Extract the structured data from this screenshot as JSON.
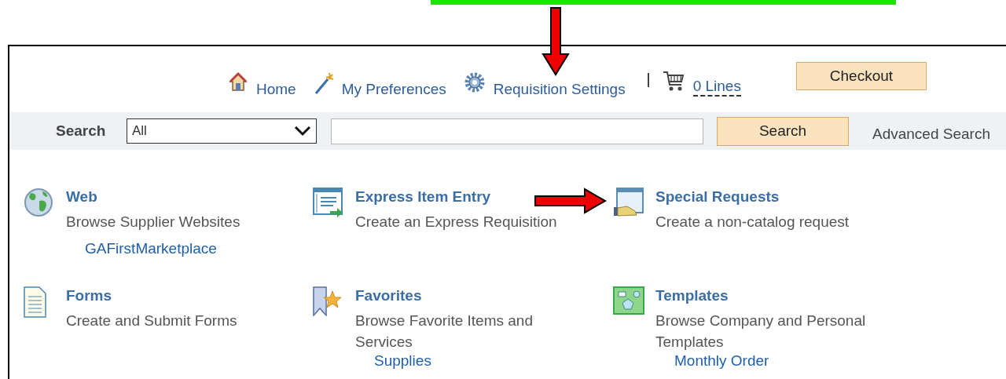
{
  "nav": {
    "links": [
      {
        "label": "Home"
      },
      {
        "label": "My Preferences"
      },
      {
        "label": "Requisition Settings"
      }
    ],
    "cart": {
      "label": "0 Lines"
    },
    "checkout": {
      "label": "Checkout"
    }
  },
  "search": {
    "label": "Search",
    "scope": "All",
    "button": "Search",
    "advanced": "Advanced Search"
  },
  "tiles": [
    {
      "title": "Web",
      "description": "Browse Supplier Websites",
      "link": "GAFirstMarketplace"
    },
    {
      "title": "Express Item Entry",
      "description": "Create an Express Requisition"
    },
    {
      "title": "Special Requests",
      "description": "Create a non-catalog request"
    },
    {
      "title": "Forms",
      "description": "Create and Submit Forms"
    },
    {
      "title": "Favorites",
      "description": "Browse Favorite Items and Services",
      "link": "Supplies"
    },
    {
      "title": "Templates",
      "description": "Browse Company and Personal Templates",
      "link": "Monthly Order"
    }
  ]
}
